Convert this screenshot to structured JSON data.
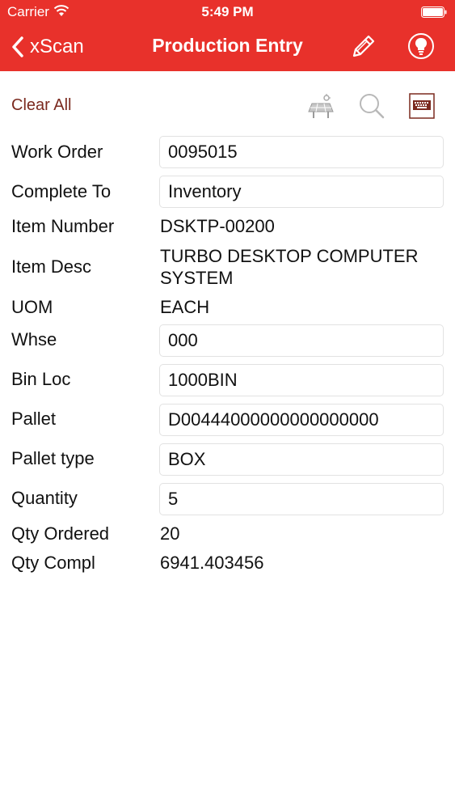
{
  "status_bar": {
    "carrier": "Carrier",
    "time": "5:49 PM"
  },
  "navbar": {
    "back_label": "xScan",
    "title": "Production Entry",
    "bg_color": "#e8312b"
  },
  "toolbar": {
    "clear_all": "Clear All",
    "icons": [
      "solar-panel-icon",
      "search-icon",
      "keyboard-icon"
    ]
  },
  "form": {
    "work_order": {
      "label": "Work Order",
      "value": "0095015"
    },
    "complete_to": {
      "label": "Complete To",
      "value": "Inventory"
    },
    "item_number": {
      "label": "Item Number",
      "value": "DSKTP-00200"
    },
    "item_desc": {
      "label": "Item Desc",
      "value_line1": "TURBO DESKTOP COMPUTER",
      "value_line2": "SYSTEM"
    },
    "uom": {
      "label": "UOM",
      "value": "EACH"
    },
    "whse": {
      "label": "Whse",
      "value": "000"
    },
    "bin_loc": {
      "label": "Bin Loc",
      "value": "1000BIN"
    },
    "pallet": {
      "label": "Pallet",
      "value": "D00444000000000000000"
    },
    "pallet_type": {
      "label": "Pallet type",
      "value": "BOX"
    },
    "quantity": {
      "label": "Quantity",
      "value": "5"
    },
    "qty_ordered": {
      "label": "Qty Ordered",
      "value": "20"
    },
    "qty_compl": {
      "label": "Qty Compl",
      "value": "6941.403456"
    }
  }
}
